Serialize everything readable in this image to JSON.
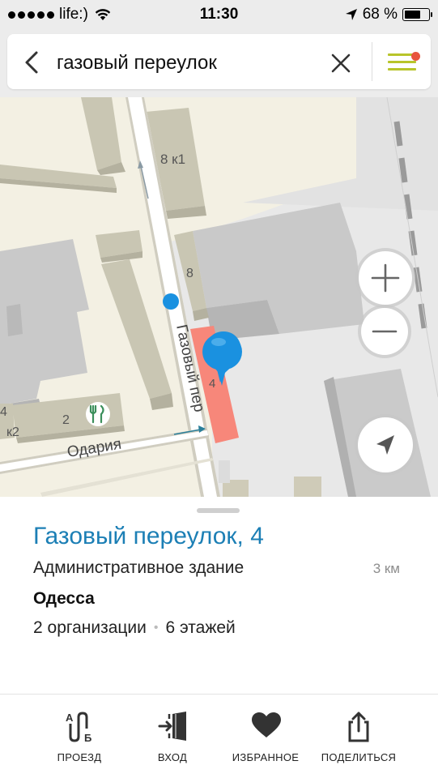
{
  "status_bar": {
    "carrier": "life:)",
    "time": "11:30",
    "battery": "68 %",
    "battery_level": 0.68
  },
  "search": {
    "query": "газовый переулок"
  },
  "map": {
    "street_vertical": "Газовый пер",
    "street_horizontal": "Одария",
    "building_labels": [
      "8 к1",
      "8",
      "4",
      "2",
      "к2",
      "4"
    ]
  },
  "card": {
    "title": "Газовый переулок, 4",
    "type": "Административное здание",
    "distance": "3 км",
    "city": "Одесса",
    "organizations": "2 организации",
    "floors": "6 этажей"
  },
  "toolbar": {
    "route": "ПРОЕЗД",
    "entrance": "ВХОД",
    "favorites": "ИЗБРАННОЕ",
    "share": "ПОДЕЛИТЬСЯ",
    "route_icon_a": "А",
    "route_icon_b": "Б"
  },
  "icons": {
    "back": "chevron-left-icon",
    "clear": "close-icon",
    "menu": "menu-icon",
    "zoom_in": "plus-icon",
    "zoom_out": "minus-icon",
    "locate": "location-arrow-icon",
    "route": "route-icon",
    "entrance": "entrance-icon",
    "favorites": "heart-icon",
    "share": "share-icon"
  },
  "colors": {
    "accent": "#1c7fb5",
    "menu": "#b8c42a",
    "notification": "#e8553e",
    "selected_building": "#f7877a",
    "pin": "#1a91e0"
  }
}
